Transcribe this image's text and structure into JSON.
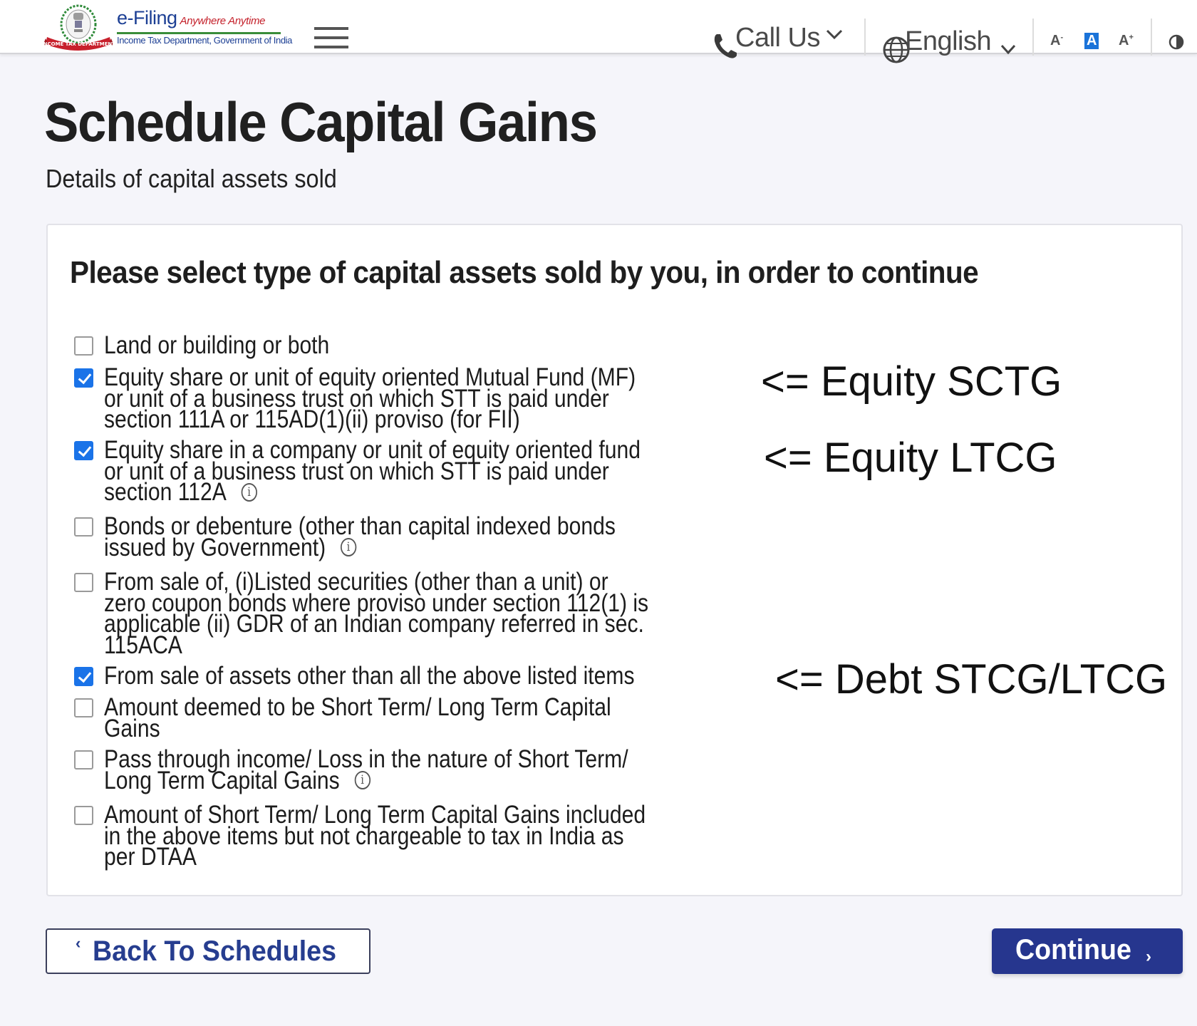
{
  "header": {
    "brand_title": "e-Filing",
    "brand_tagline": "Anywhere Anytime",
    "brand_subtitle": "Income Tax Department, Government of India",
    "logo_icon": "income-tax-department-emblem",
    "menu_icon": "hamburger-menu-icon",
    "call_us_label": "Call Us",
    "language_label": "English",
    "font_decrease_label": "A",
    "font_decrease_sup": "-",
    "font_default_label": "A",
    "font_increase_label": "A",
    "font_increase_sup": "+",
    "contrast_icon": "contrast-icon"
  },
  "page": {
    "title": "Schedule Capital Gains",
    "subtitle": "Details of capital assets sold"
  },
  "card": {
    "heading": "Please select type of capital assets sold by you, in order to continue",
    "options": [
      {
        "lines": [
          "Land or building or both"
        ],
        "checked": false,
        "info": false
      },
      {
        "lines": [
          "Equity share or unit of equity oriented Mutual Fund (MF)",
          "or unit of a business trust on which STT is paid under",
          "section 111A or 115AD(1)(ii) proviso (for FII)"
        ],
        "checked": true,
        "info": false
      },
      {
        "lines": [
          "Equity share in a company or unit of equity oriented fund",
          "or unit of a business trust on which STT is paid under",
          "section 112A"
        ],
        "checked": true,
        "info": true
      },
      {
        "lines": [
          "Bonds or debenture (other than capital indexed bonds",
          "issued by Government)"
        ],
        "checked": false,
        "info": true
      },
      {
        "lines": [
          "From sale of, (i)Listed securities (other than a unit) or",
          "zero coupon bonds where proviso under section 112(1) is",
          "applicable (ii) GDR of an Indian company referred in sec.",
          "115ACA"
        ],
        "checked": false,
        "info": false
      },
      {
        "lines": [
          "From sale of assets other than all the above listed items"
        ],
        "checked": true,
        "info": false
      },
      {
        "lines": [
          "Amount deemed to be Short Term/ Long Term Capital",
          "Gains"
        ],
        "checked": false,
        "info": false
      },
      {
        "lines": [
          "Pass through income/ Loss in the nature of Short Term/",
          "Long Term Capital Gains"
        ],
        "checked": false,
        "info": true
      },
      {
        "lines": [
          "Amount of Short Term/ Long Term Capital Gains included",
          "in the above items but not chargeable to tax in India as",
          "per DTAA"
        ],
        "checked": false,
        "info": false
      }
    ],
    "info_glyph": "i"
  },
  "annotations": {
    "equity_stcg": "<= Equity SCTG",
    "equity_ltcg": "<= Equity LTCG",
    "debt": "<= Debt STCG/LTCG"
  },
  "footer": {
    "back_label": "Back To Schedules",
    "back_chevron": "‹",
    "continue_label": "Continue",
    "continue_chevron": "›"
  },
  "colors": {
    "primary": "#26368e",
    "checkbox_checked": "#1a73e8",
    "background": "#f5f5fa",
    "brand_blue": "#1c3f94",
    "brand_red": "#c4202a"
  }
}
